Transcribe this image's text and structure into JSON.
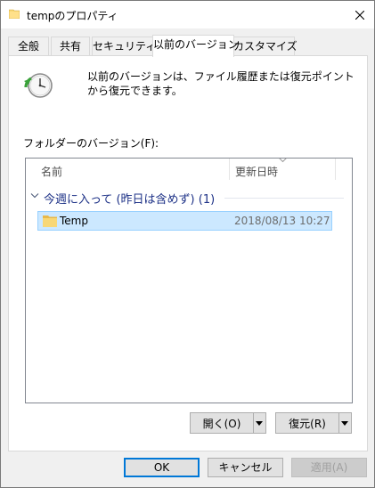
{
  "window": {
    "title": "tempのプロパティ"
  },
  "tabs": [
    {
      "label": "全般"
    },
    {
      "label": "共有"
    },
    {
      "label": "セキュリティ"
    },
    {
      "label": "以前のバージョン"
    },
    {
      "label": "カスタマイズ"
    }
  ],
  "active_tab": "以前のバージョン",
  "panel": {
    "description": "以前のバージョンは、ファイル履歴または復元ポイントから復元できます。",
    "folder_versions_label": "フォルダーのバージョン(F):",
    "columns": {
      "name": "名前",
      "modified": "更新日時"
    },
    "groups": [
      {
        "label": "今週に入って (昨日は含めず) (1)",
        "items": [
          {
            "name": "Temp",
            "modified": "2018/08/13 10:27"
          }
        ]
      }
    ],
    "open_button": "開く(O)",
    "restore_button": "復元(R)"
  },
  "footer": {
    "ok": "OK",
    "cancel": "キャンセル",
    "apply": "適用(A)"
  },
  "colors": {
    "selection_bg": "#cce8ff",
    "selection_border": "#99d1ff",
    "group_text": "#1e3287",
    "default_button_border": "#0078d7",
    "folder_yellow": "#f8d775"
  }
}
